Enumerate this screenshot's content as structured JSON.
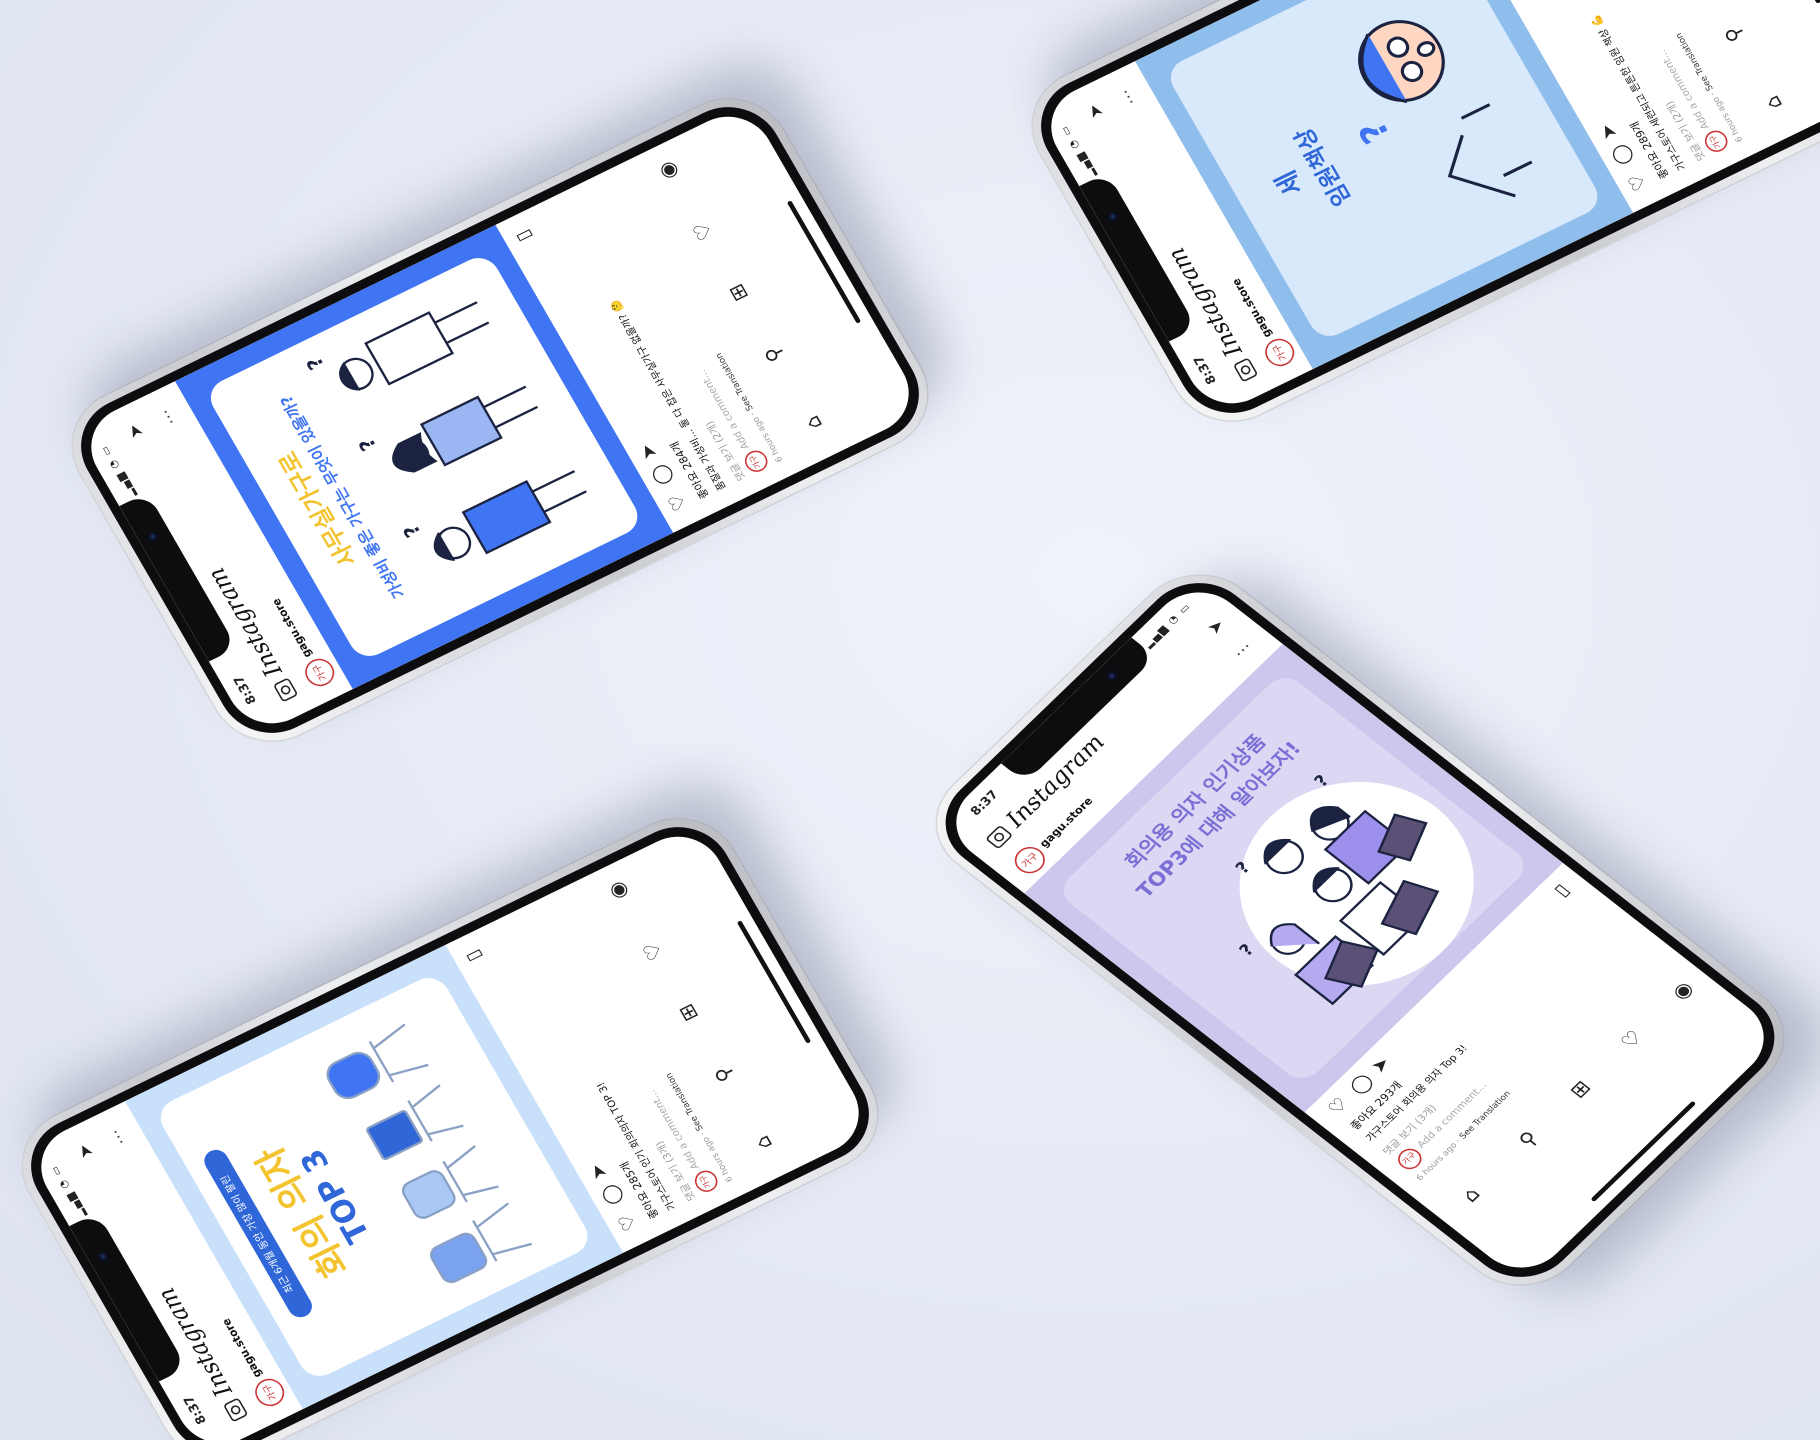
{
  "status": {
    "time": "8:37"
  },
  "app": {
    "name": "Instagram"
  },
  "account": {
    "username": "gagu.store",
    "avatar_label": "가구"
  },
  "posts": [
    {
      "title_line1": "사무실가구로",
      "title_line2": "가성비 좋은 가구는 무엇이 있을까?",
      "likes": "좋아요 284개",
      "caption": "품질과 가성비... 둘 다 잡은 사무실가구 없을까? 🤔",
      "comments": "댓글 보기 (2개)",
      "add_comment": "Add a comment...",
      "time_ago": "6 hours ago",
      "see_translation": "See Translation",
      "bg": "#3f74f2"
    },
    {
      "title_line1": "세",
      "title_line2": "임원책상",
      "likes": "좋아요 289개",
      "caption": "가구스토어 세련되고 튼튼한 임원 책상 💪",
      "comments": "댓글 보기 (2개)",
      "add_comment": "Add a comment...",
      "time_ago": "6 hours ago",
      "see_translation": "See Translation",
      "bg": "#b9d6f5"
    },
    {
      "title_line1": "회의용 의자 인기상품",
      "title_line2": "TOP3에 대해 알아보자!",
      "likes": "좋아요 293개",
      "caption": "가구스토어 회의용 의자 Top 3!",
      "comments": "댓글 보기 (3개)",
      "add_comment": "Add a comment...",
      "time_ago": "6 hours ago",
      "see_translation": "See Translation",
      "bg": "#cdc7ee"
    },
    {
      "badge": "최근 6개월 동안 가장 많이 팔린",
      "title_line1": "회의 의자",
      "title_line2": "TOP 3",
      "likes": "좋아요 285개",
      "caption": "가구스토어 인기 회의의자 TOP 3!",
      "comments": "댓글 보기 (3개)",
      "add_comment": "Add a comment...",
      "time_ago": "6 hours ago",
      "see_translation": "See Translation",
      "bg": "#c9e0fb"
    }
  ],
  "icons": {
    "camera": "camera-icon",
    "send": "send-icon",
    "more": "more-icon",
    "heart": "heart-icon",
    "comment": "comment-icon",
    "share": "share-icon",
    "bookmark": "bookmark-icon",
    "home": "home-icon",
    "search": "search-icon",
    "add": "add-post-icon",
    "activity": "heart-icon",
    "profile": "profile-icon"
  },
  "colors": {
    "accent_blue": "#3f74f2",
    "accent_yellow": "#f4c430",
    "lavender": "#cdc7ee",
    "light_blue": "#b9d6f5"
  }
}
